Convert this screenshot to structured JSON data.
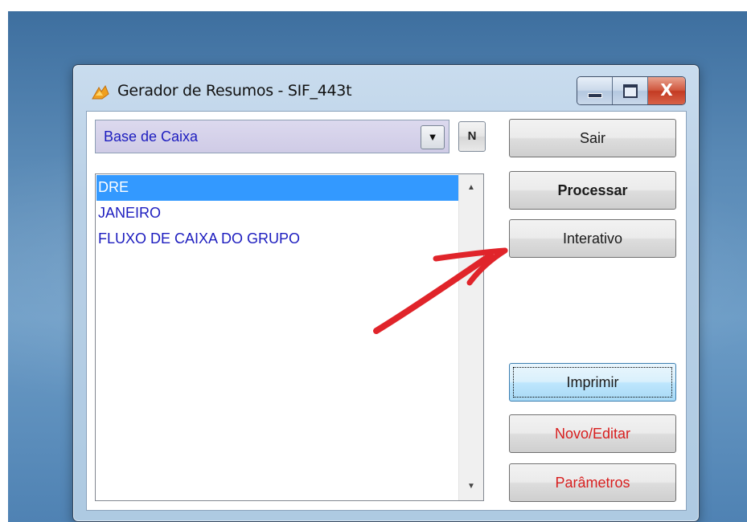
{
  "window": {
    "title": "Gerador de Resumos - SIF_443t",
    "controls": {
      "minimize": "minimize",
      "maximize": "maximize",
      "close": "X"
    }
  },
  "combo": {
    "selected": "Base de Caixa",
    "arrow": "▼"
  },
  "n_button": "N",
  "list": {
    "items": [
      "DRE",
      "JANEIRO",
      "FLUXO DE CAIXA DO GRUPO"
    ],
    "selected_index": 0,
    "scroll_up": "▲",
    "scroll_down": "▼"
  },
  "buttons": {
    "sair": "Sair",
    "processar": "Processar",
    "interativo": "Interativo",
    "imprimir": "Imprimir",
    "novo_editar": "Novo/Editar",
    "parametros": "Parâmetros"
  },
  "colors": {
    "list_text": "#1d1dbf",
    "selection": "#3399ff",
    "red_label": "#d81e1e",
    "annotation_arrow": "#e0242a"
  },
  "annotation": {
    "shape": "red-arrow",
    "points_to": "Interativo"
  }
}
